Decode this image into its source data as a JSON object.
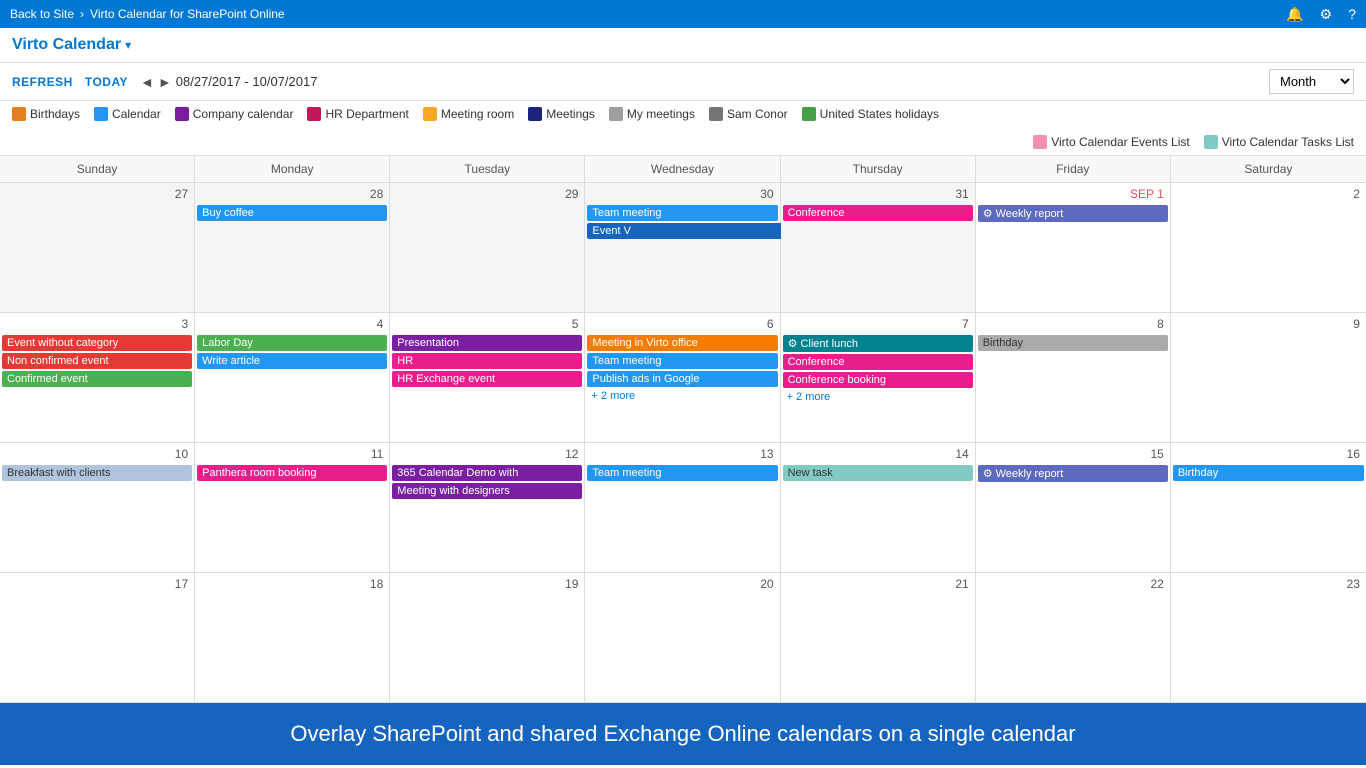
{
  "topbar": {
    "back": "Back to Site",
    "separator": "›",
    "title": "Virto Calendar for SharePoint Online",
    "icons": [
      "🔔",
      "⚙",
      "?"
    ]
  },
  "appHeader": {
    "title": "Virto Calendar",
    "arrow": "▾"
  },
  "toolbar": {
    "refresh": "REFRESH",
    "today": "TODAY",
    "prev": "◄",
    "next": "►",
    "dateRange": "08/27/2017 - 10/07/2017",
    "view": "Month"
  },
  "legend": {
    "items": [
      {
        "label": "Birthdays",
        "color": "#e67e22"
      },
      {
        "label": "Calendar",
        "color": "#2196f3"
      },
      {
        "label": "Company calendar",
        "color": "#7b1fa2"
      },
      {
        "label": "HR Department",
        "color": "#c2185b"
      },
      {
        "label": "Meeting room",
        "color": "#f9a825"
      },
      {
        "label": "Meetings",
        "color": "#1a237e"
      },
      {
        "label": "My meetings",
        "color": "#9e9e9e"
      },
      {
        "label": "Sam Conor",
        "color": "#757575"
      },
      {
        "label": "United States holidays",
        "color": "#43a047"
      }
    ],
    "row2items": [
      {
        "label": "Virto Calendar Events List",
        "color": "#f48fb1"
      },
      {
        "label": "Virto Calendar Tasks List",
        "color": "#80cbc4"
      }
    ]
  },
  "calendar": {
    "headers": [
      "Sunday",
      "Monday",
      "Tuesday",
      "Wednesday",
      "Thursday",
      "Friday",
      "Saturday"
    ],
    "footer": "Overlay SharePoint and shared Exchange Online calendars on a single calendar"
  }
}
